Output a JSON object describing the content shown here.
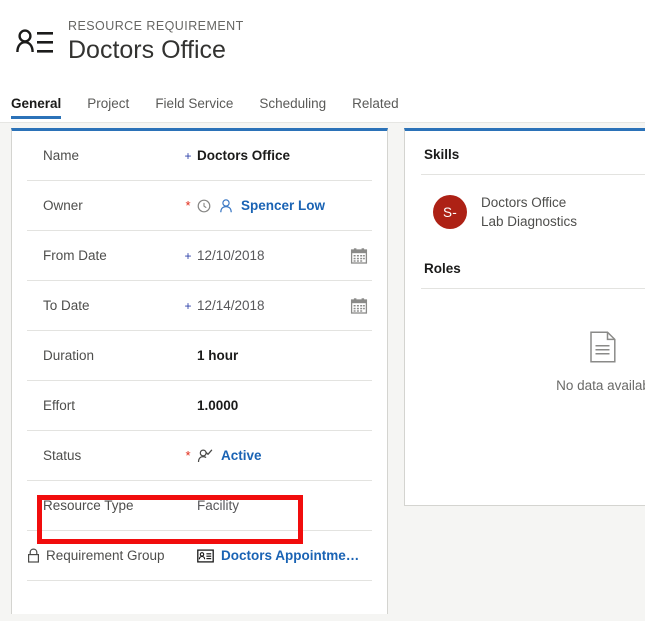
{
  "header": {
    "icon": "contact-list-icon",
    "eyebrow": "RESOURCE REQUIREMENT",
    "title": "Doctors Office"
  },
  "tabs": [
    {
      "label": "General",
      "active": true
    },
    {
      "label": "Project",
      "active": false
    },
    {
      "label": "Field Service",
      "active": false
    },
    {
      "label": "Scheduling",
      "active": false
    },
    {
      "label": "Related",
      "active": false
    }
  ],
  "form": {
    "fields": [
      {
        "label": "Name",
        "marker": "plus",
        "value": "Doctors Office",
        "style": "bold"
      },
      {
        "label": "Owner",
        "marker": "star",
        "value": "Spencer Low",
        "style": "link"
      },
      {
        "label": "From Date",
        "marker": "plus",
        "value": "12/10/2018",
        "style": "muted"
      },
      {
        "label": "To Date",
        "marker": "plus",
        "value": "12/14/2018",
        "style": "muted"
      },
      {
        "label": "Duration",
        "marker": "",
        "value": "1 hour",
        "style": "bold"
      },
      {
        "label": "Effort",
        "marker": "",
        "value": "1.0000",
        "style": "bold"
      },
      {
        "label": "Status",
        "marker": "star",
        "value": "Active",
        "style": "link"
      },
      {
        "label": "Resource Type",
        "marker": "",
        "value": "Facility",
        "style": "muted"
      },
      {
        "label": "Requirement Group",
        "marker": "",
        "value": "Doctors Appointme…",
        "style": "link"
      }
    ]
  },
  "annotation": {
    "target": "Resource Type",
    "color": "#f10d0d"
  },
  "panel": {
    "skills": {
      "heading": "Skills",
      "item": {
        "avatar_initials": "S-",
        "avatar_color": "#ad2115",
        "line1": "Doctors Office",
        "line2": "Lab Diagnostics"
      }
    },
    "roles": {
      "heading": "Roles",
      "empty_text": "No data availab"
    }
  },
  "colors": {
    "accent": "#2b72b8",
    "link": "#1a63b4",
    "required_star": "#e12a18",
    "required_plus": "#2b3fa8",
    "canvas": "#f5f5f3"
  }
}
